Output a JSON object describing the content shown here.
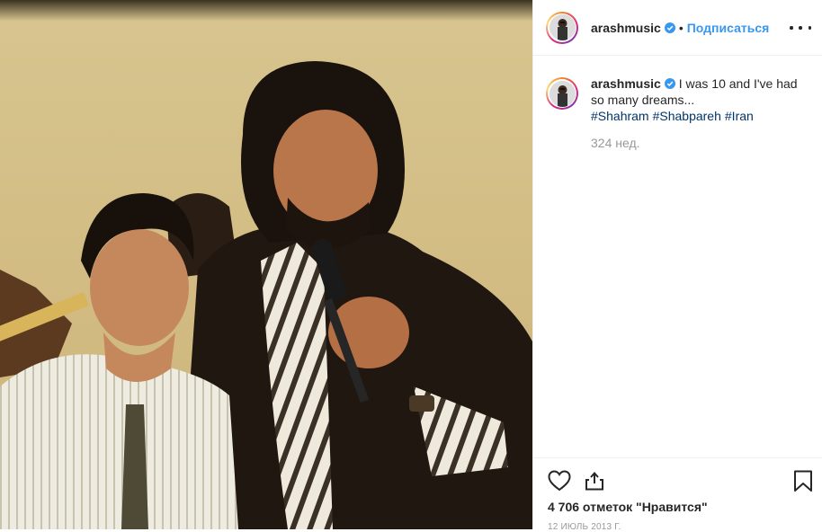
{
  "post": {
    "photo_alt": "",
    "author": {
      "username": "arashmusic",
      "verified": true
    },
    "header": {
      "separator": "•",
      "follow_label": "Подписаться"
    },
    "caption": {
      "text": "I was 10 and I've had so many dreams...",
      "hashtags": [
        "#Shahram",
        "#Shabpareh",
        "#Iran"
      ],
      "age": "324 нед."
    },
    "likes_text": "4 706 отметок \"Нравится\"",
    "date_text": "12 июль 2013 г."
  },
  "icons": {
    "more": "more-options-icon",
    "like": "heart-icon",
    "share": "share-icon",
    "save": "bookmark-icon",
    "verified": "verified-badge-icon"
  },
  "colors": {
    "accent_blue": "#3897f0",
    "hashtag": "#003569",
    "muted": "#999999",
    "text": "#262626",
    "border": "#efefef"
  }
}
